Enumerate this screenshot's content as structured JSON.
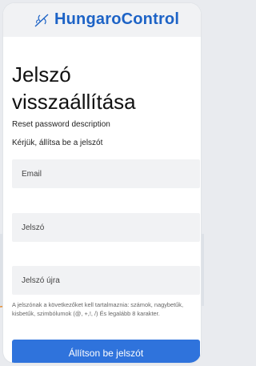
{
  "brand": {
    "name": "HungaroControl",
    "icon": "plane-logo-icon",
    "color": "#1d63c6"
  },
  "page": {
    "title": "Jelszó visszaállítása",
    "description": "Reset password description",
    "prompt": "Kérjük, állítsa be a jelszót"
  },
  "form": {
    "email_placeholder": "Email",
    "password_placeholder": "Jelszó",
    "password_repeat_placeholder": "Jelszó újra",
    "hint": "A jelszónak a következőket kell tartalmaznia: számok, nagybetűk, kisbetűk, szimbólumok (@, +,!, /) És legalább 8 karakter.",
    "submit_label": "Állítson be jelszót"
  },
  "colors": {
    "accent": "#2f73dc",
    "decor_line": "#e6913a"
  }
}
